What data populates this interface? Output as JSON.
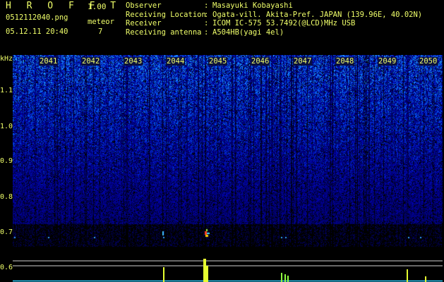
{
  "header": {
    "app_title": "H R O F F T",
    "version": "1.00",
    "filename": "0512112040.png",
    "datetime": "05.12.11 20:40",
    "meteor_label": "meteor",
    "meteor_count": "7",
    "info": [
      {
        "key": "Observer",
        "sep": ":",
        "value": "Masayuki Kobayashi"
      },
      {
        "key": "Receiving Location",
        "sep": ":",
        "value": "Ogata-vill. Akita-Pref. JAPAN (139.96E, 40.02N)"
      },
      {
        "key": "Receiver",
        "sep": ":",
        "value": "ICOM IC-575 53.7492(@LCD)MHz USB"
      },
      {
        "key": "Receiving antenna",
        "sep": ":",
        "value": "A504HB(yagi 4el)"
      }
    ]
  },
  "spectrogram": {
    "unit_label": "kHz",
    "y_ticks": [
      "1.1",
      "1.0",
      "0.9",
      "0.8",
      "0.7",
      "0.6"
    ],
    "x_ticks": [
      "2041",
      "2042",
      "2043",
      "2044",
      "2045",
      "2046",
      "2047",
      "2048",
      "2049",
      "2050"
    ],
    "colors": {
      "text": "#f0ff6a",
      "noise_dark": "#0a1a6e",
      "noise_bright": "#4db8ff",
      "meteor": "#ff4020",
      "trace": "#e6ff30"
    }
  }
}
